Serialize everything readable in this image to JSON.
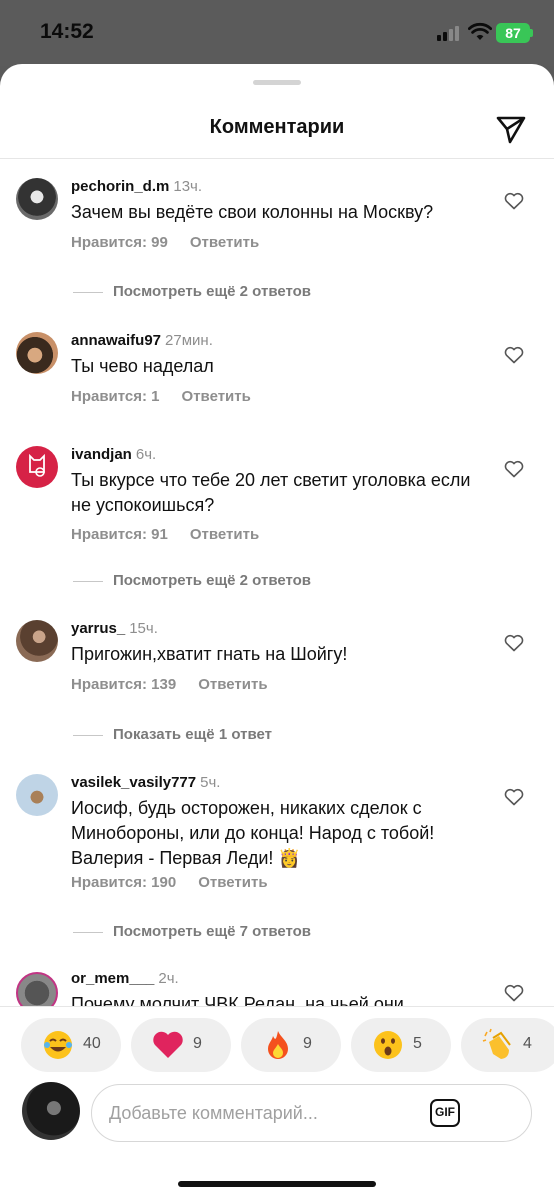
{
  "status": {
    "time": "14:52",
    "battery": "87"
  },
  "sheet": {
    "title": "Комментарии",
    "share_icon": "paper-plane-icon"
  },
  "comments": [
    {
      "user": "pechorin_d.m",
      "time": "13ч.",
      "text": "Зачем вы ведёте свои колонны на Москву?",
      "likes": "Нравится: 99",
      "reply": "Ответить",
      "more": "Посмотреть ещё 2 ответов"
    },
    {
      "user": "annawaifu97",
      "time": "27мин.",
      "text": "Ты чево наделал",
      "likes": "Нравится: 1",
      "reply": "Ответить",
      "more": ""
    },
    {
      "user": "ivandjan",
      "time": "6ч.",
      "text": "Ты вкурсе что тебе 20 лет светит уголовка если не успокоишься?",
      "likes": "Нравится: 91",
      "reply": "Ответить",
      "more": "Посмотреть ещё 2 ответов"
    },
    {
      "user": "yarrus_",
      "time": "15ч.",
      "text": "Пригожин,хватит гнать на Шойгу!",
      "likes": "Нравится: 139",
      "reply": "Ответить",
      "more": "Показать ещё 1 ответ"
    },
    {
      "user": "vasilek_vasily777",
      "time": "5ч.",
      "text": "Иосиф, будь осторожен, никаких сделок с Минобороны, или до конца! Народ с тобой! Валерия - Первая Леди! 👸",
      "likes": "Нравится: 190",
      "reply": "Ответить",
      "more": "Посмотреть ещё 7 ответов"
    },
    {
      "user": "or_mem___",
      "time": "2ч.",
      "text": "Почему молчит ЧВК Редан, на чьей они",
      "likes": "",
      "reply": "",
      "more": ""
    }
  ],
  "reactions": [
    {
      "emoji": "😂",
      "icon": "tears-of-joy-icon",
      "count": "40"
    },
    {
      "emoji": "❤️",
      "icon": "red-heart-icon",
      "count": "9"
    },
    {
      "emoji": "🔥",
      "icon": "fire-icon",
      "count": "9"
    },
    {
      "emoji": "😮",
      "icon": "surprised-face-icon",
      "count": "5"
    },
    {
      "emoji": "👏",
      "icon": "clapping-hands-icon",
      "count": "4"
    }
  ],
  "composer": {
    "placeholder": "Добавьте комментарий...",
    "gif_label": "GIF"
  },
  "colors": {
    "heart_reaction": "#e0245e",
    "battery": "#39c657",
    "muted_text": "#8e8e8e"
  }
}
